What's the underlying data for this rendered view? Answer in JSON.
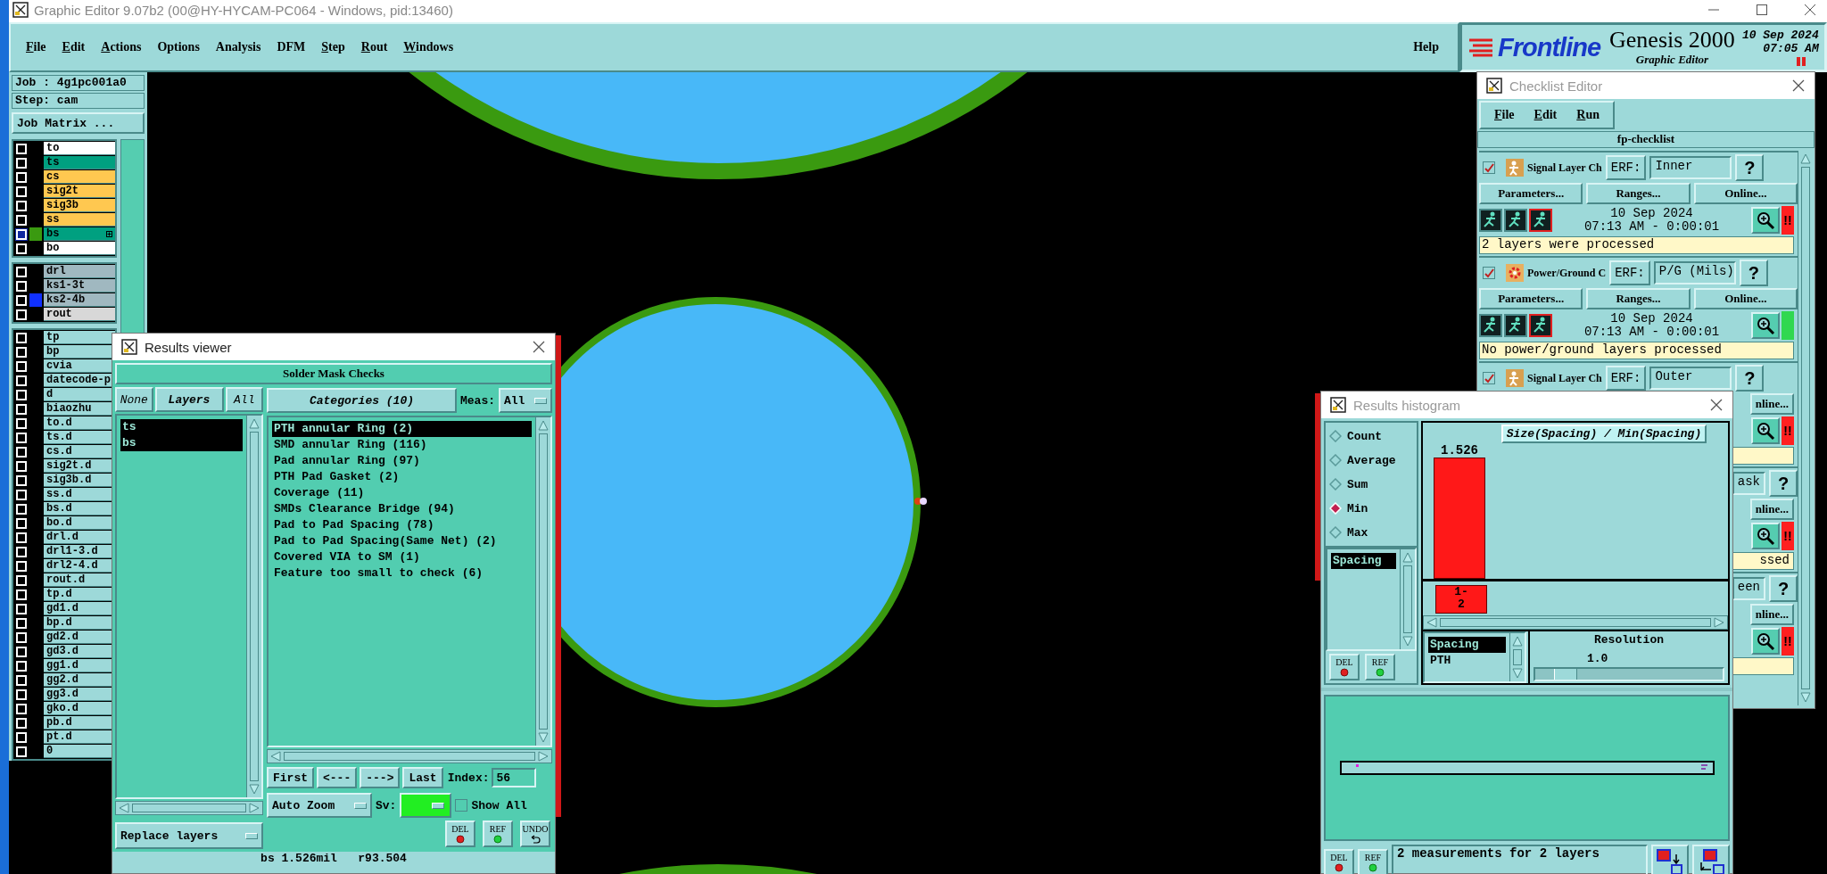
{
  "window": {
    "title": "Graphic Editor 9.07b2 (00@HY-HYCAM-PC064 - Windows, pid:13460)"
  },
  "menu": [
    {
      "label": "File",
      "mnemonic": true
    },
    {
      "label": "Edit",
      "mnemonic": true
    },
    {
      "label": "Actions",
      "mnemonic": true
    },
    {
      "label": "Options",
      "mnemonic": false
    },
    {
      "label": "Analysis",
      "mnemonic": false
    },
    {
      "label": "DFM",
      "mnemonic": false
    },
    {
      "label": "Step",
      "mnemonic": true
    },
    {
      "label": "Rout",
      "mnemonic": true
    },
    {
      "label": "Windows",
      "mnemonic": true
    }
  ],
  "help": "Help",
  "brand": {
    "logo": "Frontline",
    "product": "Genesis 2000",
    "subtitle": "Graphic Editor",
    "date": "10 Sep 2024",
    "time": "07:05 AM"
  },
  "job_panel": {
    "job": "Job : 4g1pc001a0",
    "step": "Step: cam",
    "matrix_button": "Job Matrix ..."
  },
  "layer_groups": [
    [
      {
        "name": "to",
        "color": "#ffffff",
        "work_layer": false
      },
      {
        "name": "ts",
        "color": "#00a080",
        "work_layer": false
      },
      {
        "name": "cs",
        "color": "#ffc850",
        "work_layer": false
      },
      {
        "name": "sig2t",
        "color": "#ffc850",
        "work_layer": false
      },
      {
        "name": "sig3b",
        "color": "#ffc850",
        "work_layer": false
      },
      {
        "name": "ss",
        "color": "#ffc850",
        "work_layer": false
      },
      {
        "name": "bs",
        "color": "#00a080",
        "swatch": {
          "color": "#3a9a10"
        },
        "work_layer": true
      },
      {
        "name": "bo",
        "color": "#ffffff",
        "work_layer": false
      }
    ],
    [
      {
        "name": "drl",
        "color": "#a0b8c0",
        "work_layer": false
      },
      {
        "name": "ks1-3t",
        "color": "#a0b8c0",
        "work_layer": false
      },
      {
        "name": "ks2-4b",
        "color": "#a0b8c0",
        "swatch": {
          "color": "#1030ff"
        },
        "work_layer": false
      },
      {
        "name": "rout",
        "color": "#d8d8d8",
        "work_layer": false
      }
    ],
    [
      {
        "name": "tp",
        "color": "#9dd9d9",
        "work_layer": false
      },
      {
        "name": "bp",
        "color": "#9dd9d9",
        "work_layer": false
      },
      {
        "name": "cvia",
        "color": "#9dd9d9",
        "work_layer": false
      },
      {
        "name": "datecode-p",
        "color": "#9dd9d9",
        "work_layer": false
      },
      {
        "name": "d",
        "color": "#9dd9d9",
        "work_layer": false
      },
      {
        "name": "biaozhu",
        "color": "#9dd9d9",
        "work_layer": false
      },
      {
        "name": "to.d",
        "color": "#9dd9d9",
        "work_layer": false
      },
      {
        "name": "ts.d",
        "color": "#9dd9d9",
        "work_layer": false
      },
      {
        "name": "cs.d",
        "color": "#9dd9d9",
        "work_layer": false
      },
      {
        "name": "sig2t.d",
        "color": "#9dd9d9",
        "work_layer": false
      },
      {
        "name": "sig3b.d",
        "color": "#9dd9d9",
        "work_layer": false
      },
      {
        "name": "ss.d",
        "color": "#9dd9d9",
        "work_layer": false
      },
      {
        "name": "bs.d",
        "color": "#9dd9d9",
        "work_layer": false
      },
      {
        "name": "bo.d",
        "color": "#9dd9d9",
        "work_layer": false
      },
      {
        "name": "drl.d",
        "color": "#9dd9d9",
        "work_layer": false
      },
      {
        "name": "drl1-3.d",
        "color": "#9dd9d9",
        "work_layer": false
      },
      {
        "name": "drl2-4.d",
        "color": "#9dd9d9",
        "work_layer": false
      },
      {
        "name": "rout.d",
        "color": "#9dd9d9",
        "work_layer": false
      },
      {
        "name": "tp.d",
        "color": "#9dd9d9",
        "work_layer": false
      },
      {
        "name": "gd1.d",
        "color": "#9dd9d9",
        "work_layer": false
      },
      {
        "name": "bp.d",
        "color": "#9dd9d9",
        "work_layer": false
      },
      {
        "name": "gd2.d",
        "color": "#9dd9d9",
        "work_layer": false
      },
      {
        "name": "gd3.d",
        "color": "#9dd9d9",
        "work_layer": false
      },
      {
        "name": "gg1.d",
        "color": "#9dd9d9",
        "work_layer": false
      },
      {
        "name": "gg2.d",
        "color": "#9dd9d9",
        "work_layer": false
      },
      {
        "name": "gg3.d",
        "color": "#9dd9d9",
        "work_layer": false
      },
      {
        "name": "gko.d",
        "color": "#9dd9d9",
        "work_layer": false
      },
      {
        "name": "pb.d",
        "color": "#9dd9d9",
        "work_layer": false
      },
      {
        "name": "pt.d",
        "color": "#9dd9d9",
        "work_layer": false
      },
      {
        "name": "0",
        "color": "#9dd9d9",
        "work_layer": false
      }
    ]
  ],
  "results_viewer": {
    "title": "Results viewer",
    "header": "Solder Mask Checks",
    "layer_buttons": [
      "None",
      "Layers",
      "All"
    ],
    "layers": [
      {
        "label": "ts",
        "selected": true
      },
      {
        "label": "bs",
        "selected": true
      }
    ],
    "replace_dropdown": "Replace layers",
    "categories_button": "Categories (10)",
    "meas_label": "Meas:",
    "meas_value": "All",
    "categories": [
      {
        "label": "PTH annular Ring (2)",
        "selected": true
      },
      {
        "label": "SMD annular Ring (116)",
        "selected": false
      },
      {
        "label": "Pad annular Ring (97)",
        "selected": false
      },
      {
        "label": "PTH Pad Gasket (2)",
        "selected": false
      },
      {
        "label": "Coverage (11)",
        "selected": false
      },
      {
        "label": "SMDs Clearance Bridge (94)",
        "selected": false
      },
      {
        "label": "Pad to Pad Spacing (78)",
        "selected": false
      },
      {
        "label": "Pad to Pad Spacing(Same Net) (2)",
        "selected": false
      },
      {
        "label": "Covered VIA to SM (1)",
        "selected": false
      },
      {
        "label": "Feature too small to check (6)",
        "selected": false
      }
    ],
    "nav_buttons": [
      "First",
      "<---",
      "--->",
      "Last"
    ],
    "index_label": "Index:",
    "index_value": "56",
    "auto_zoom": "Auto Zoom",
    "sv": {
      "label": "Sv:",
      "color": "#22ee22"
    },
    "show_all": {
      "label": "Show All",
      "checked": false
    },
    "action_buttons": [
      {
        "label": "DEL",
        "kind": "delete"
      },
      {
        "label": "REF",
        "kind": "refresh"
      },
      {
        "label": "UNDO",
        "kind": "undo"
      }
    ],
    "status": "bs 1.526mil   r93.504"
  },
  "checklist": {
    "title": "Checklist Editor",
    "menu": [
      {
        "label": "File",
        "mnemonic": true
      },
      {
        "label": "Edit",
        "mnemonic": true
      },
      {
        "label": "Run",
        "mnemonic": true
      }
    ],
    "name": "fp-checklist",
    "checks": [
      {
        "kind": "signal",
        "checked": true,
        "name": "Signal Layer Ch",
        "erf_label": "ERF:",
        "erf": "Inner",
        "help": "?",
        "buttons": [
          "Parameters...",
          "Ranges...",
          "Online..."
        ],
        "date": "10 Sep 2024",
        "time": "07:13 AM - 0:00:01",
        "color": "#ff2020",
        "status_text": "!!",
        "message": "2 layers were processed"
      },
      {
        "kind": "power",
        "checked": true,
        "name": "Power/Ground C",
        "erf_label": "ERF:",
        "erf": "P/G (Mils)",
        "help": "?",
        "buttons": [
          "Parameters...",
          "Ranges...",
          "Online..."
        ],
        "date": "10 Sep 2024",
        "time": "07:13 AM - 0:00:01",
        "color": "#30d850",
        "message": "No power/ground layers processed"
      },
      {
        "kind": "signal",
        "checked": true,
        "name": "Signal Layer Ch",
        "erf_label": "ERF:",
        "erf": "Outer",
        "help": "?",
        "buttons": [
          "nline..."
        ],
        "color": "#ff2020",
        "status_text": "!!"
      },
      {
        "erf": "ask",
        "help": "?",
        "buttons": [
          "nline..."
        ],
        "color": "#ff2020",
        "status_text": "!!",
        "message": "ssed"
      },
      {
        "erf": "een",
        "help": "?",
        "buttons": [
          "nline..."
        ],
        "color": "#ff2020",
        "status_text": "!!"
      }
    ]
  },
  "histogram": {
    "title": "Results histogram",
    "modes": [
      {
        "label": "Count",
        "selected": false
      },
      {
        "label": "Average",
        "selected": false
      },
      {
        "label": "Sum",
        "selected": false
      },
      {
        "label": "Min",
        "selected": true
      },
      {
        "label": "Max",
        "selected": false
      }
    ],
    "measures": [
      {
        "label": "Spacing",
        "selected": true
      }
    ],
    "list_buttons": [
      {
        "label": "DEL",
        "kind": "delete"
      },
      {
        "label": "REF",
        "kind": "refresh"
      }
    ],
    "chart_title": "Size(Spacing) / Min(Spacing)",
    "bar_label": "1.526",
    "bin_label": "1-2",
    "types": [
      {
        "label": "Spacing",
        "selected": true
      },
      {
        "label": "PTH",
        "selected": false
      }
    ],
    "resolution_label": "Resolution",
    "resolution_value": "1.0",
    "resolution_slider": {
      "level": 0.1
    },
    "buttons": [
      {
        "label": "DEL",
        "kind": "delete"
      },
      {
        "label": "REF",
        "kind": "refresh"
      }
    ],
    "status": "2 measurements for 2 layers"
  }
}
